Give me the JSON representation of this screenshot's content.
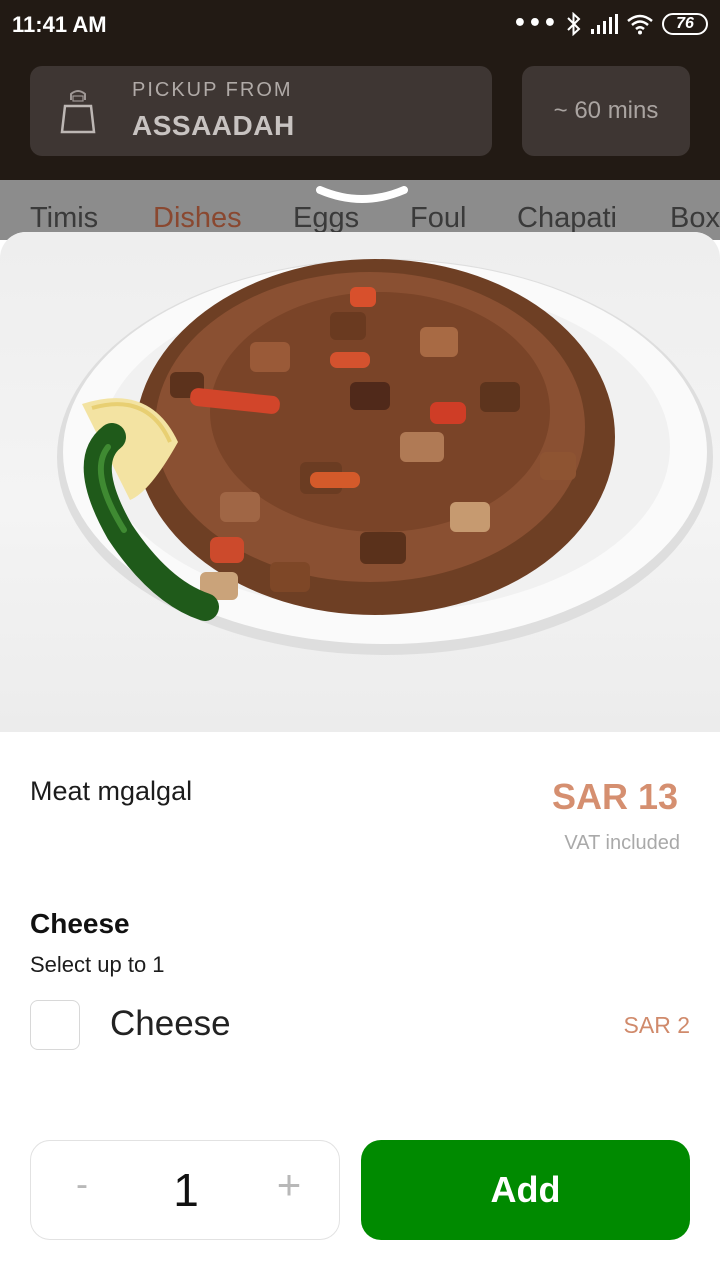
{
  "status_bar": {
    "time": "11:41 AM",
    "dots": "•••",
    "battery": "76",
    "icons": [
      "bluetooth-icon",
      "cellular-signal-icon",
      "wifi-icon",
      "battery-icon"
    ]
  },
  "header": {
    "pickup_label": "PICKUP FROM",
    "pickup_location": "ASSAADAH",
    "eta": "~ 60 mins",
    "icon": "shopping-bag-icon"
  },
  "tabs": [
    {
      "label": "Timis",
      "active": false
    },
    {
      "label": "Dishes",
      "active": true
    },
    {
      "label": "Eggs",
      "active": false
    },
    {
      "label": "Foul",
      "active": false
    },
    {
      "label": "Chapati",
      "active": false
    },
    {
      "label": "Box",
      "active": false
    }
  ],
  "dish": {
    "name": "Meat mgalgal",
    "price": "SAR 13",
    "vat_note": "VAT included"
  },
  "options": {
    "title": "Cheese",
    "subtitle": "Select up to 1",
    "items": [
      {
        "label": "Cheese",
        "price": "SAR 2",
        "checked": false
      }
    ]
  },
  "stepper": {
    "minus": "-",
    "quantity": "1",
    "plus": "+"
  },
  "add_button": {
    "label": "Add"
  },
  "colors": {
    "header_bg": "#221a14",
    "card_bg": "#3e3633",
    "price_accent": "#d58f70",
    "add_button": "#008a00",
    "active_tab": "#8a4830"
  }
}
